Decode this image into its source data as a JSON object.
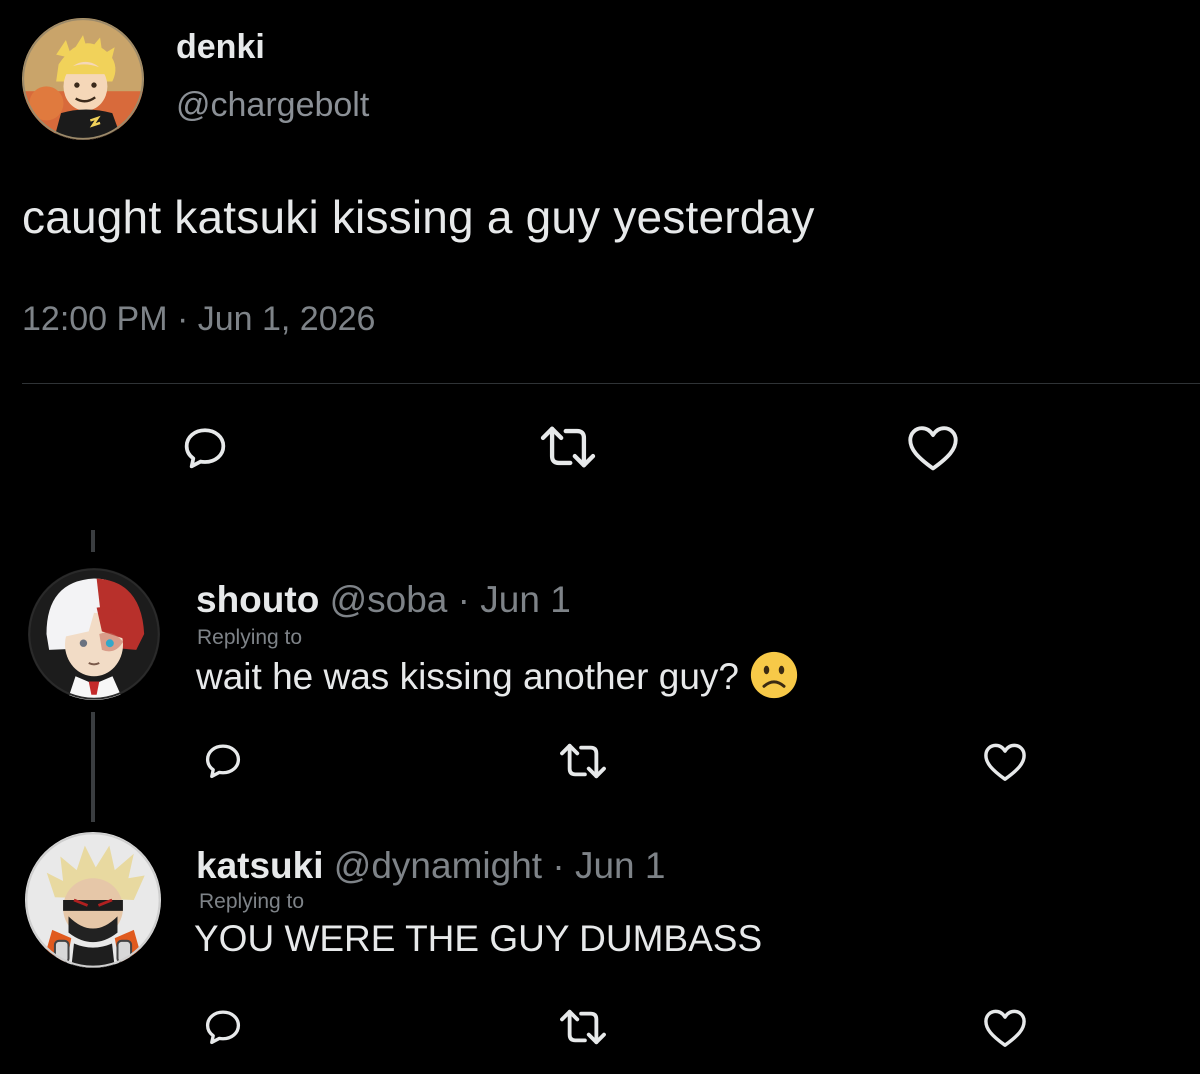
{
  "tweet": {
    "author": {
      "name": "denki",
      "handle": "@chargebolt"
    },
    "text": "caught katsuki kissing a guy yesterday",
    "timestamp": "12:00 PM · Jun 1, 2026",
    "actions": {
      "reply_icon": "reply-icon",
      "retweet_icon": "retweet-icon",
      "like_icon": "heart-icon"
    }
  },
  "replies": [
    {
      "name": "shouto",
      "handle": "@soba",
      "separator": " · ",
      "date": "Jun 1",
      "replying_to": "Replying to",
      "text": "wait he was kissing another guy?",
      "emoji": "slightly-frowning-face"
    },
    {
      "name": "katsuki",
      "handle": "@dynamight",
      "separator": " · ",
      "date": "Jun 1",
      "replying_to": "Replying to",
      "text": "YOU WERE THE GUY DUMBASS"
    }
  ],
  "colors": {
    "background": "#000000",
    "text": "#e7e9ea",
    "secondary": "#7e8388",
    "divider": "#2f3336",
    "emoji_face": "#f7c948"
  }
}
